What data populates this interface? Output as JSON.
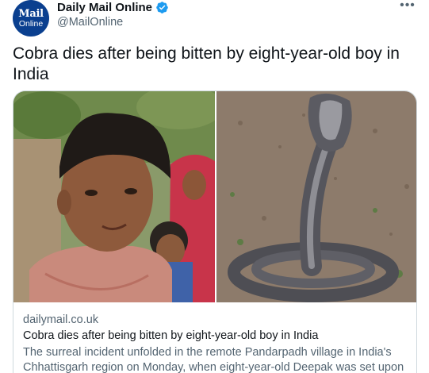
{
  "account": {
    "display_name": "Daily Mail Online",
    "handle": "@MailOnline",
    "verified": true,
    "avatar_text_top": "Mail",
    "avatar_text_bottom": "Online",
    "avatar_color": "#0a3f8f"
  },
  "icons": {
    "verified": "verified-badge-icon",
    "more": "more-options-icon"
  },
  "more_glyph": "•••",
  "tweet": {
    "text": "Cobra dies after being bitten by eight-year-old boy in India"
  },
  "card": {
    "domain": "dailymail.co.uk",
    "title": "Cobra dies after being bitten by eight-year-old boy in India",
    "description": "The surreal incident unfolded in the remote Pandarpadh village in India's Chhattisgarh region on Monday, when eight-year-old Deepak was set upon by ..."
  },
  "colors": {
    "accent_blue": "#1d9bf0",
    "text_primary": "#0f1419",
    "text_secondary": "#536471",
    "border": "#cfd9de"
  }
}
